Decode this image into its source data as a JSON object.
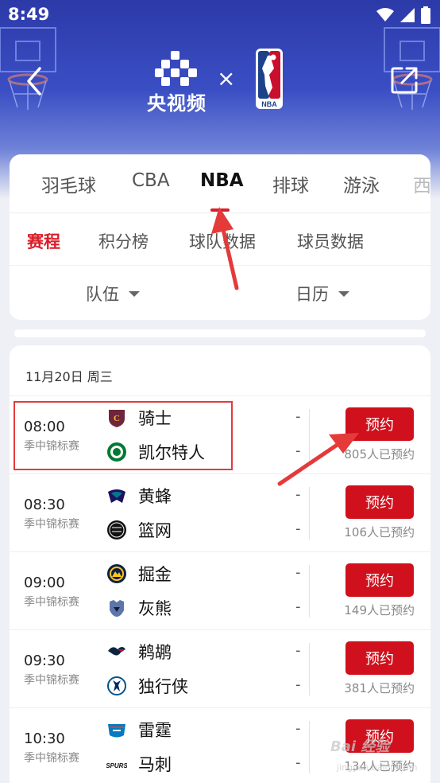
{
  "status_bar": {
    "time": "8:49",
    "icons": [
      "wifi-icon",
      "signal-icon",
      "battery-icon"
    ]
  },
  "header": {
    "brand_name": "央视频",
    "cross": "×",
    "partner_logo_text": "NBA",
    "back_icon": "chevron-left-icon",
    "share_icon": "share-icon"
  },
  "sport_tabs": {
    "items": [
      "羽毛球",
      "CBA",
      "NBA",
      "排球",
      "游泳",
      "西"
    ],
    "active": "NBA"
  },
  "sub_tabs": {
    "items": [
      "赛程",
      "积分榜",
      "球队数据",
      "球员数据"
    ],
    "active": "赛程"
  },
  "filters": {
    "team": "队伍",
    "calendar": "日历"
  },
  "schedule": {
    "date": "11月20日 周三",
    "matches": [
      {
        "time": "08:00",
        "league": "季中锦标赛",
        "home": "骑士",
        "away": "凯尔特人",
        "home_score": "-",
        "away_score": "-",
        "button": "预约",
        "count": "805人已预约",
        "home_logo": "cavaliers-logo",
        "away_logo": "celtics-logo"
      },
      {
        "time": "08:30",
        "league": "季中锦标赛",
        "home": "黄蜂",
        "away": "篮网",
        "home_score": "-",
        "away_score": "-",
        "button": "预约",
        "count": "106人已预约",
        "home_logo": "hornets-logo",
        "away_logo": "nets-logo"
      },
      {
        "time": "09:00",
        "league": "季中锦标赛",
        "home": "掘金",
        "away": "灰熊",
        "home_score": "-",
        "away_score": "-",
        "button": "预约",
        "count": "149人已预约",
        "home_logo": "nuggets-logo",
        "away_logo": "grizzlies-logo"
      },
      {
        "time": "09:30",
        "league": "季中锦标赛",
        "home": "鹈鹕",
        "away": "独行侠",
        "home_score": "-",
        "away_score": "-",
        "button": "预约",
        "count": "381人已预约",
        "home_logo": "pelicans-logo",
        "away_logo": "mavericks-logo"
      },
      {
        "time": "10:30",
        "league": "季中锦标赛",
        "home": "雷霆",
        "away": "马刺",
        "home_score": "-",
        "away_score": "-",
        "button": "预约",
        "count": "134人已预约",
        "home_logo": "thunder-logo",
        "away_logo": "spurs-logo"
      }
    ]
  },
  "watermark": {
    "text": "Bai 经验",
    "sub": "jingyan.baidu.com"
  },
  "colors": {
    "accent": "#d0101c",
    "header_blue": "#3a4ec4",
    "annotation_red": "#e53a3a"
  }
}
